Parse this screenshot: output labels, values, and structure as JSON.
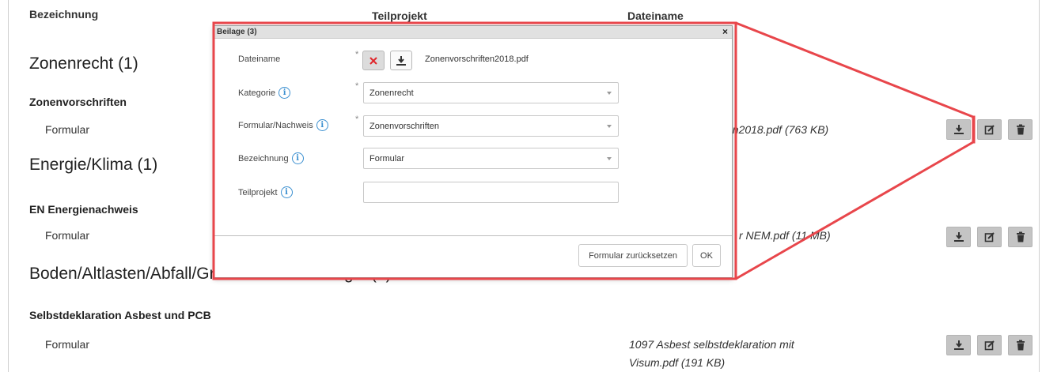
{
  "table": {
    "headers": [
      "Bezeichnung",
      "Teilprojekt",
      "Dateiname"
    ],
    "groups": [
      {
        "title": "Zonenrecht (1)",
        "item_title": "Zonenvorschriften",
        "row_label": "Formular",
        "file_text": "en2018.pdf (763 KB)"
      },
      {
        "title": "Energie/Klima (1)",
        "item_title": "EN Energienachweis",
        "row_label": "Formular",
        "file_text": "r NEM.pdf (11 MB)"
      },
      {
        "title": "Boden/Altlasten/Abfall/Grundwasser/Geologie (1)",
        "item_title": "Selbstdeklaration Asbest und PCB",
        "row_label": "Formular",
        "file_text_line1": "1097 Asbest selbstdeklaration mit",
        "file_text_line2": "Visum.pdf (191 KB)"
      }
    ],
    "row_actions": [
      "download-icon",
      "edit-icon",
      "trash-icon"
    ]
  },
  "modal": {
    "title": "Beilage (3)",
    "close": "×",
    "required_mark": "*",
    "fields": {
      "dateiname": {
        "label": "Dateiname",
        "value": "Zonenvorschriften2018.pdf"
      },
      "kategorie": {
        "label": "Kategorie",
        "value": "Zonenrecht"
      },
      "formular": {
        "label": "Formular/Nachweis",
        "value": "Zonenvorschriften"
      },
      "bezeichnung": {
        "label": "Bezeichnung",
        "value": "Formular"
      },
      "teilprojekt": {
        "label": "Teilprojekt",
        "value": ""
      }
    },
    "reset_button": "Formular zurücksetzen",
    "ok_button": "OK"
  },
  "colors": {
    "callout": "#e8464b",
    "info": "#3a8fd0",
    "action_button": "#c4c4c4",
    "remove_x": "#e0262b"
  }
}
